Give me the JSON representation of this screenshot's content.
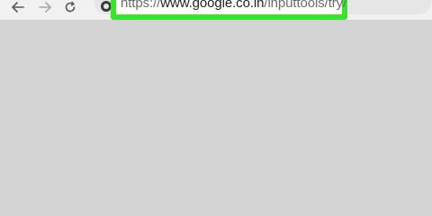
{
  "browser": {
    "nav": {
      "back_icon": "arrow-left-icon",
      "forward_icon": "arrow-right-icon",
      "reload_icon": "reload-icon",
      "site_info_icon": "site-info-icon"
    },
    "address_bar": {
      "url_scheme": "https://",
      "url_domain": "www.google.co.in",
      "url_path": "/inputtools/try/",
      "highlight_color": "#37e62a"
    }
  }
}
